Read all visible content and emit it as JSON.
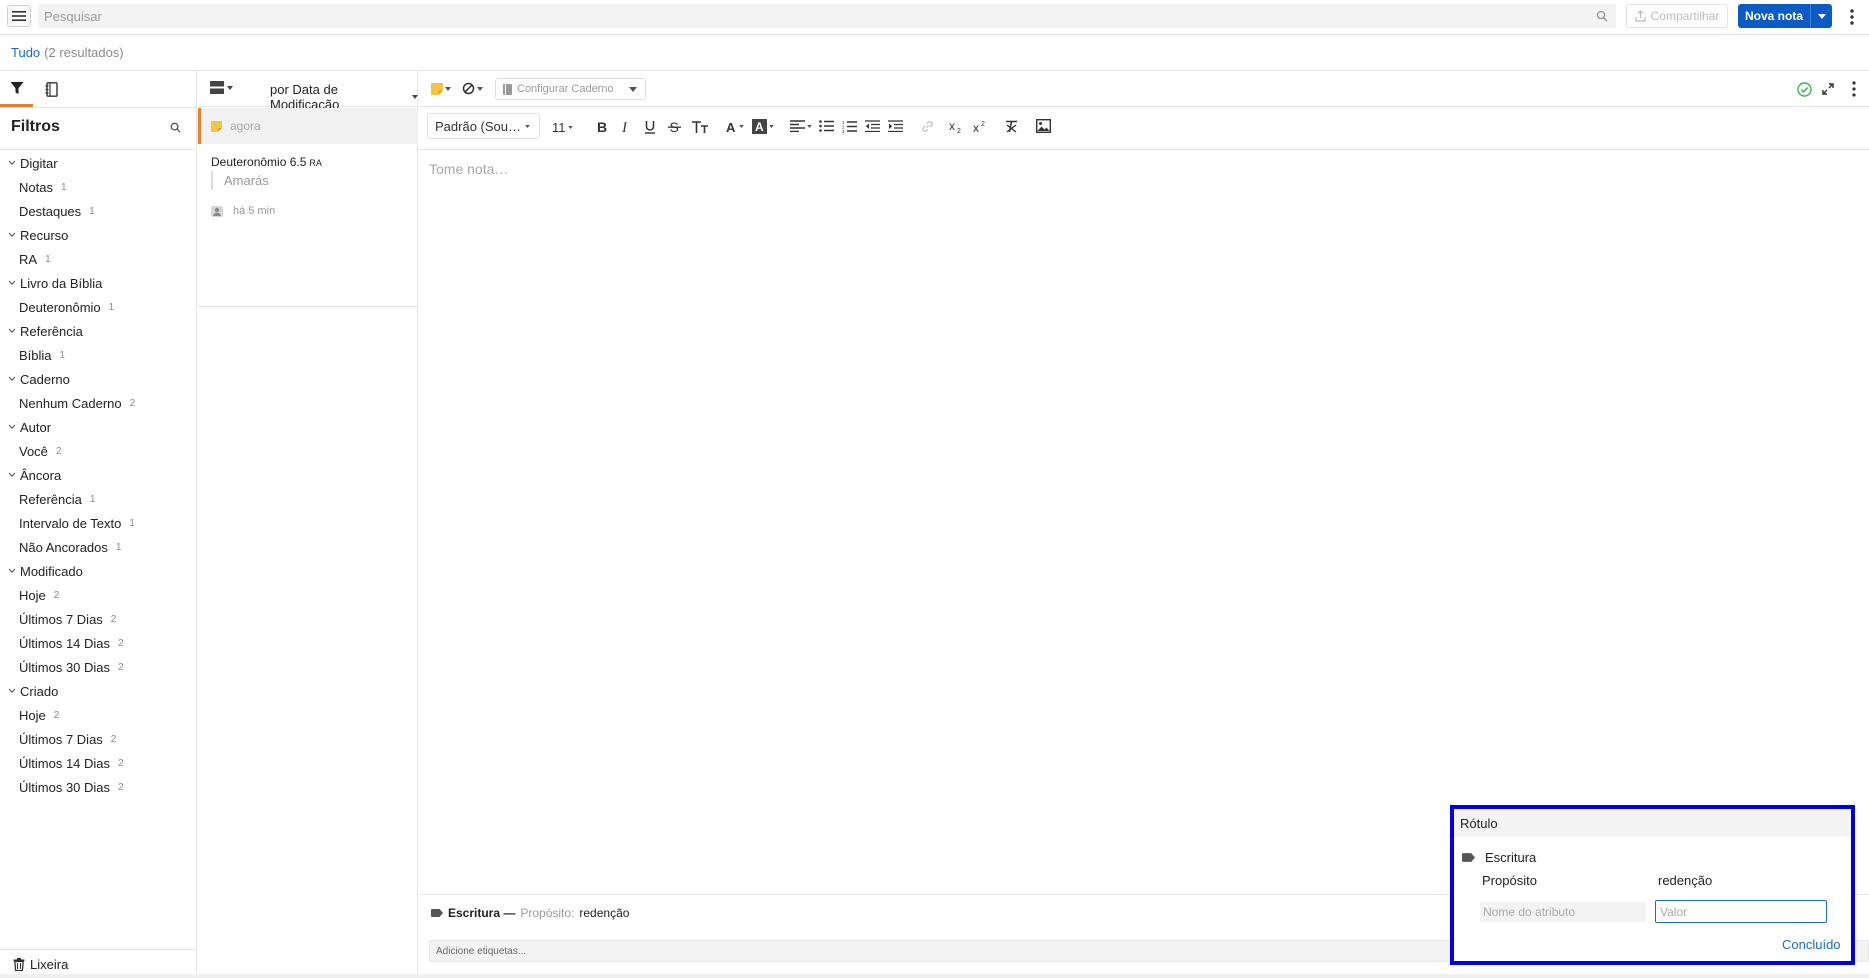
{
  "topbar": {
    "search_placeholder": "Pesquisar",
    "share_label": "Compartilhar",
    "new_note_label": "Nova nota"
  },
  "breadcrumb": {
    "scope": "Tudo",
    "results": "(2 resultados)"
  },
  "filters": {
    "title": "Filtros",
    "groups": [
      {
        "label": "Digitar",
        "items": [
          {
            "label": "Notas",
            "count": "1"
          },
          {
            "label": "Destaques",
            "count": "1"
          }
        ]
      },
      {
        "label": "Recurso",
        "items": [
          {
            "label": "RA",
            "count": "1"
          }
        ]
      },
      {
        "label": "Livro da Bíblia",
        "items": [
          {
            "label": "Deuteronômio",
            "count": "1"
          }
        ]
      },
      {
        "label": "Referência",
        "items": [
          {
            "label": "Bíblia",
            "count": "1"
          }
        ]
      },
      {
        "label": "Caderno",
        "items": [
          {
            "label": "Nenhum Caderno",
            "count": "2"
          }
        ]
      },
      {
        "label": "Autor",
        "items": [
          {
            "label": "Você",
            "count": "2"
          }
        ]
      },
      {
        "label": "Âncora",
        "items": [
          {
            "label": "Referência",
            "count": "1"
          },
          {
            "label": "Intervalo de Texto",
            "count": "1"
          },
          {
            "label": "Não Ancorados",
            "count": "1"
          }
        ]
      },
      {
        "label": "Modificado",
        "items": [
          {
            "label": "Hoje",
            "count": "2"
          },
          {
            "label": "Últimos 7 Dias",
            "count": "2"
          },
          {
            "label": "Últimos 14 Dias",
            "count": "2"
          },
          {
            "label": "Últimos 30 Dias",
            "count": "2"
          }
        ]
      },
      {
        "label": "Criado",
        "items": [
          {
            "label": "Hoje",
            "count": "2"
          },
          {
            "label": "Últimos 7 Dias",
            "count": "2"
          },
          {
            "label": "Últimos 14 Dias",
            "count": "2"
          },
          {
            "label": "Últimos 30 Dias",
            "count": "2"
          }
        ]
      }
    ],
    "trash_label": "Lixeira"
  },
  "note_list": {
    "sort_label": "por Data de Modificação",
    "active_note": {
      "time": "agora"
    },
    "card": {
      "title": "Deuteronômio 6.5",
      "resource": "RA",
      "quote": "Amarás",
      "time": "há 5 min"
    }
  },
  "editor": {
    "notebook_label": "Configurar Caderno",
    "font_label": "Padrão (Sou…",
    "font_size": "11",
    "placeholder": "Tome nota…",
    "label_summary": {
      "name": "Escritura —",
      "attr": "Propósito:",
      "value": "redenção"
    },
    "tags_placeholder": "Adicione etiquetas..."
  },
  "label_popup": {
    "header": "Rótulo",
    "label_name": "Escritura",
    "attr_key": "Propósito",
    "attr_value": "redenção",
    "name_placeholder": "Nome do atributo",
    "value_placeholder": "Valor",
    "done_label": "Concluído"
  },
  "colors": {
    "accent": "#0a5bc4",
    "active_tab": "#e8812b",
    "note_yellow": "#f4c542",
    "link": "#1a6ac9",
    "highlight_border": "#0000e6"
  }
}
